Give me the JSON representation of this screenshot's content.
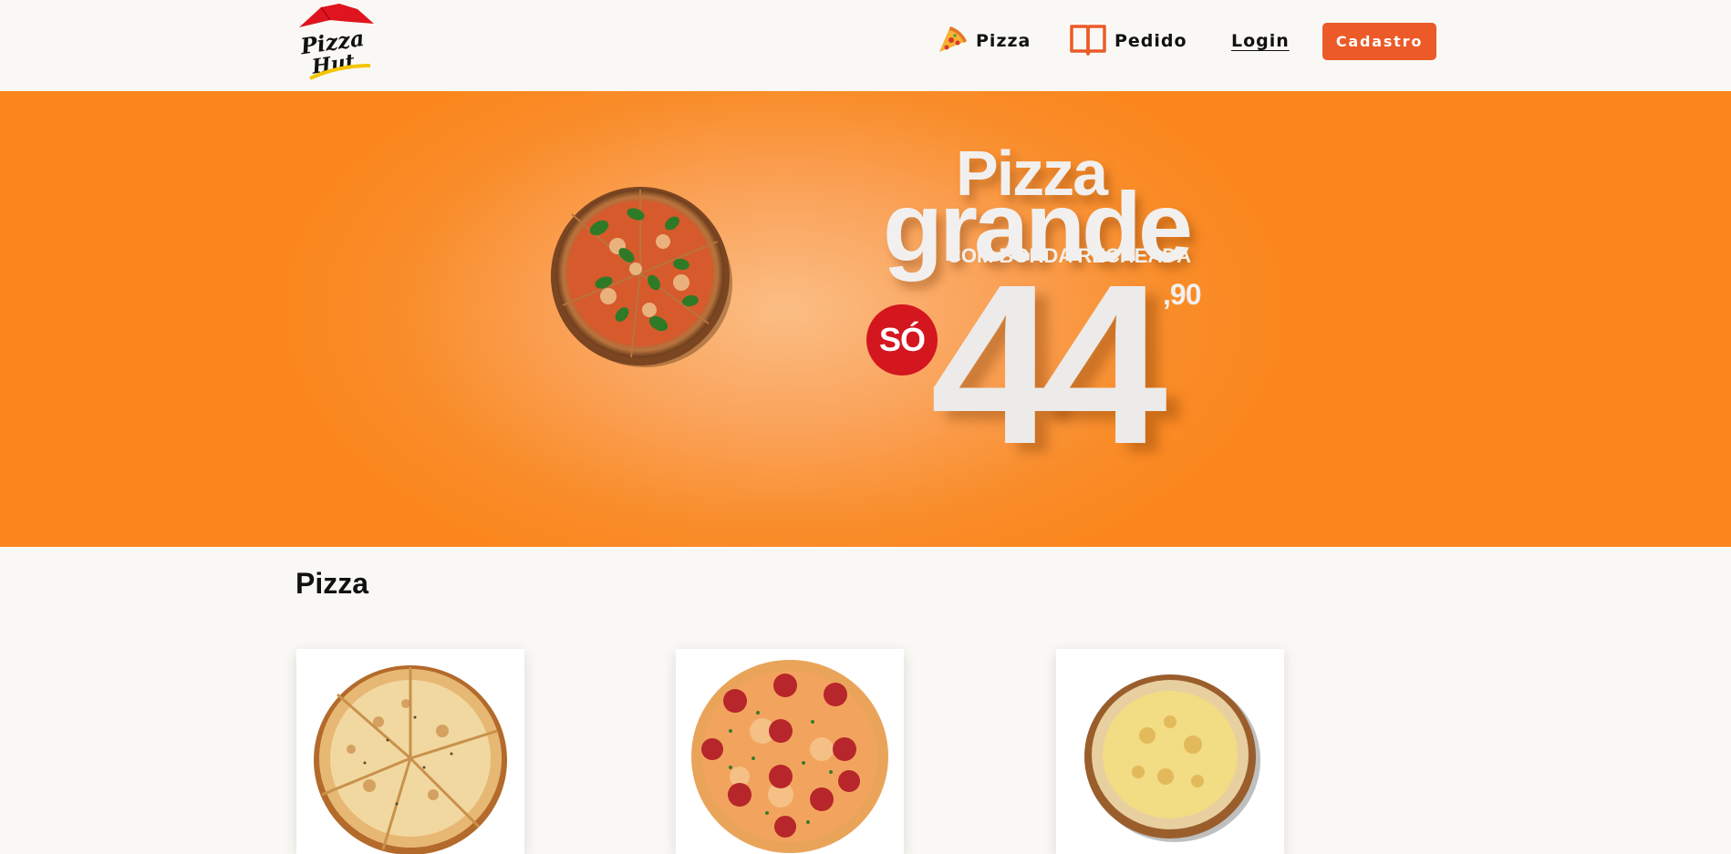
{
  "header": {
    "logo_text": "Pizza Hut",
    "nav": {
      "pizza_label": "Pizza",
      "pizza_icon": "pizza-slice-icon",
      "pedido_label": "Pedido",
      "pedido_icon": "open-book-icon",
      "login_label": "Login",
      "cadastro_label": "Cadastro"
    }
  },
  "banner": {
    "line1": "Pizza",
    "line2": "grande",
    "subtitle": "COM BORDA RECHEADA",
    "badge": "SÓ",
    "price_whole": "44",
    "price_cents": ",90"
  },
  "colors": {
    "accent": "#ec5a28",
    "banner_orange": "#fb861d",
    "badge_red": "#d4161f",
    "background": "#faf8f5"
  },
  "section": {
    "title": "Pizza"
  },
  "products": [
    {
      "icon": "white-pizza-image"
    },
    {
      "icon": "pepperoni-pizza-image"
    },
    {
      "icon": "cheese-pizza-image"
    }
  ]
}
